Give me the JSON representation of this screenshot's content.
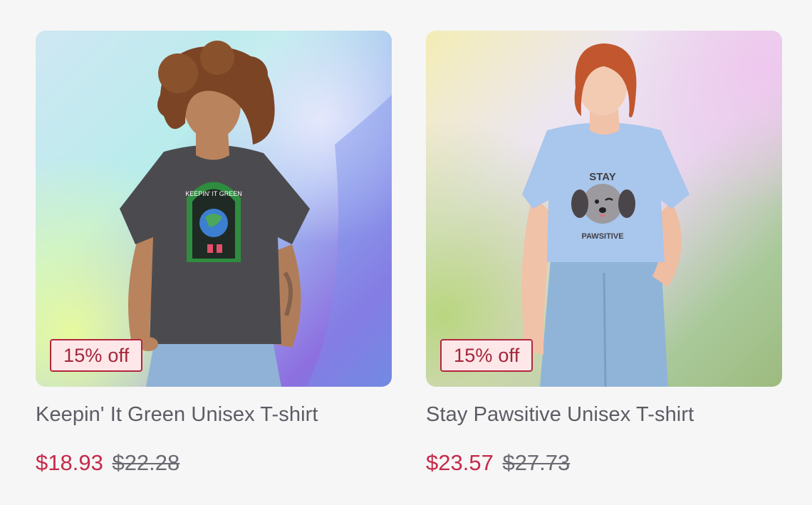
{
  "colors": {
    "page_background": "#f6f6f6",
    "sale_price": "#c52a4a",
    "badge_border": "#b3263e",
    "badge_background": "#fde7e8",
    "title_text": "#5c5c66"
  },
  "products": [
    {
      "image_icon": "tshirt-photo-keepin-it-green",
      "shirt_print": "KEEPIN' IT GREEN",
      "badge": "15% off",
      "title": "Keepin' It Green Unisex T-shirt",
      "sale_price": "$18.93",
      "original_price": "$22.28"
    },
    {
      "image_icon": "tshirt-photo-stay-pawsitive",
      "shirt_print_top": "STAY",
      "shirt_print_bottom": "PAWSITIVE",
      "badge": "15% off",
      "title": "Stay Pawsitive Unisex T-shirt",
      "sale_price": "$23.57",
      "original_price": "$27.73"
    }
  ]
}
